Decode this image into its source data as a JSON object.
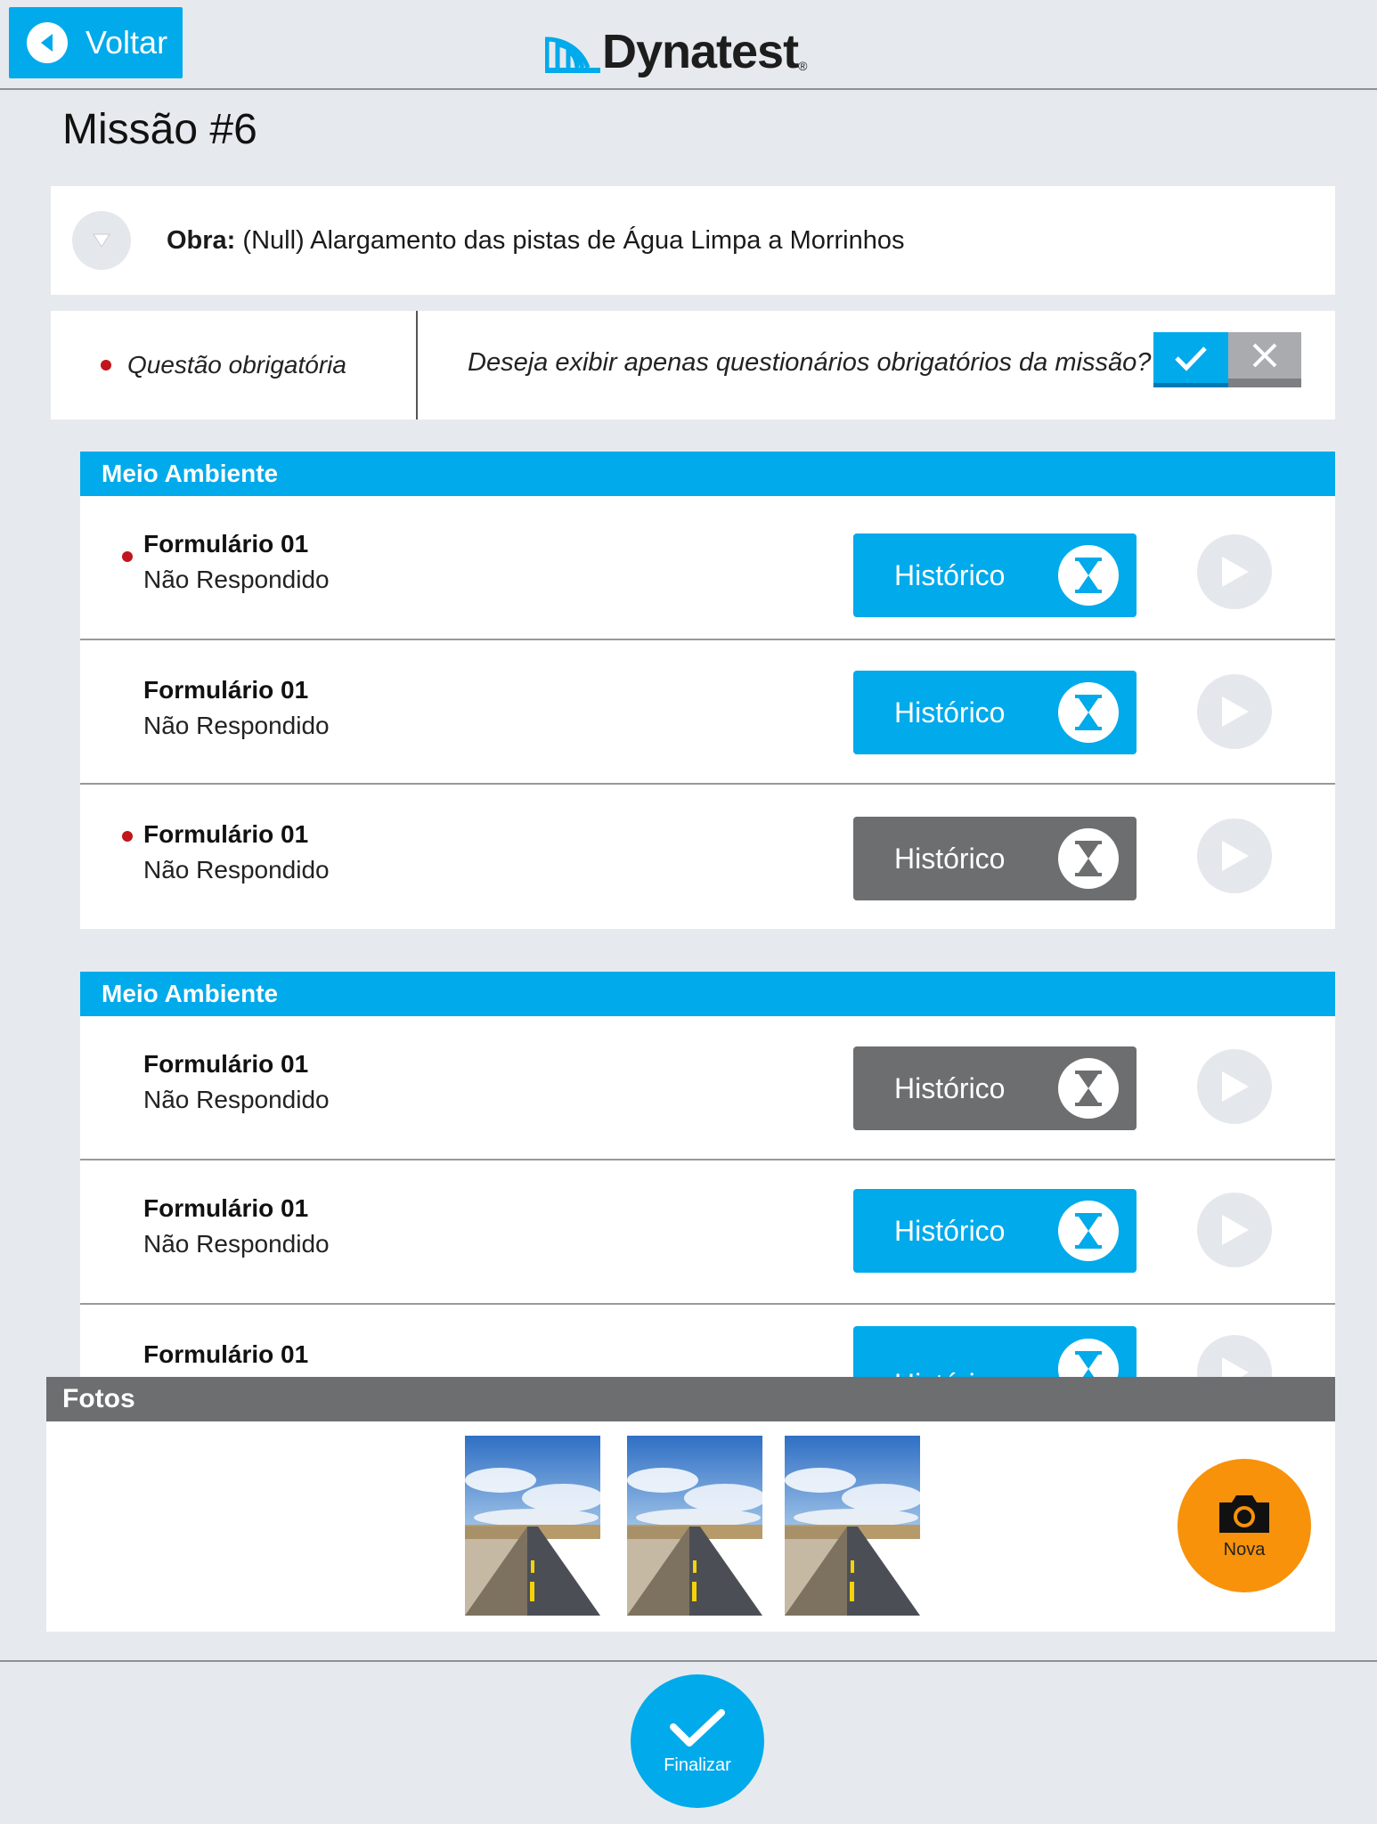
{
  "header": {
    "back_label": "Voltar",
    "logo_text": "Dynatest",
    "logo_reg": "®"
  },
  "page_title": "Missão #6",
  "obra": {
    "label": "Obra:",
    "value": "(Null) Alargamento das pistas de Água Limpa a Morrinhos"
  },
  "filter": {
    "legend": "Questão obrigatória",
    "question": "Deseja exibir apenas questionários obrigatórios da missão?",
    "selected": "yes"
  },
  "sections": [
    {
      "title": "Meio Ambiente",
      "rows": [
        {
          "name": "Formulário 01",
          "status": "Não Respondido",
          "required": true,
          "hist_label": "Histórico",
          "hist_style": "blue"
        },
        {
          "name": "Formulário 01",
          "status": "Não Respondido",
          "required": false,
          "hist_label": "Histórico",
          "hist_style": "blue"
        },
        {
          "name": "Formulário 01",
          "status": "Não Respondido",
          "required": true,
          "hist_label": "Histórico",
          "hist_style": "gray"
        }
      ]
    },
    {
      "title": "Meio Ambiente",
      "rows": [
        {
          "name": "Formulário 01",
          "status": "Não Respondido",
          "required": false,
          "hist_label": "Histórico",
          "hist_style": "gray"
        },
        {
          "name": "Formulário 01",
          "status": "Não Respondido",
          "required": false,
          "hist_label": "Histórico",
          "hist_style": "blue"
        },
        {
          "name": "Formulário 01",
          "status": "",
          "required": false,
          "hist_label": "Histórico",
          "hist_style": "blue"
        }
      ]
    }
  ],
  "fotos": {
    "title": "Fotos",
    "nova_label": "Nova",
    "thumbnails": [
      "road-photo",
      "road-photo",
      "road-photo"
    ]
  },
  "finalizar_label": "Finalizar",
  "colors": {
    "accent": "#00aaeb",
    "gray_button": "#6d6e70",
    "required_dot": "#c0161c",
    "camera_button": "#f7920a",
    "background": "#e6eaee"
  }
}
